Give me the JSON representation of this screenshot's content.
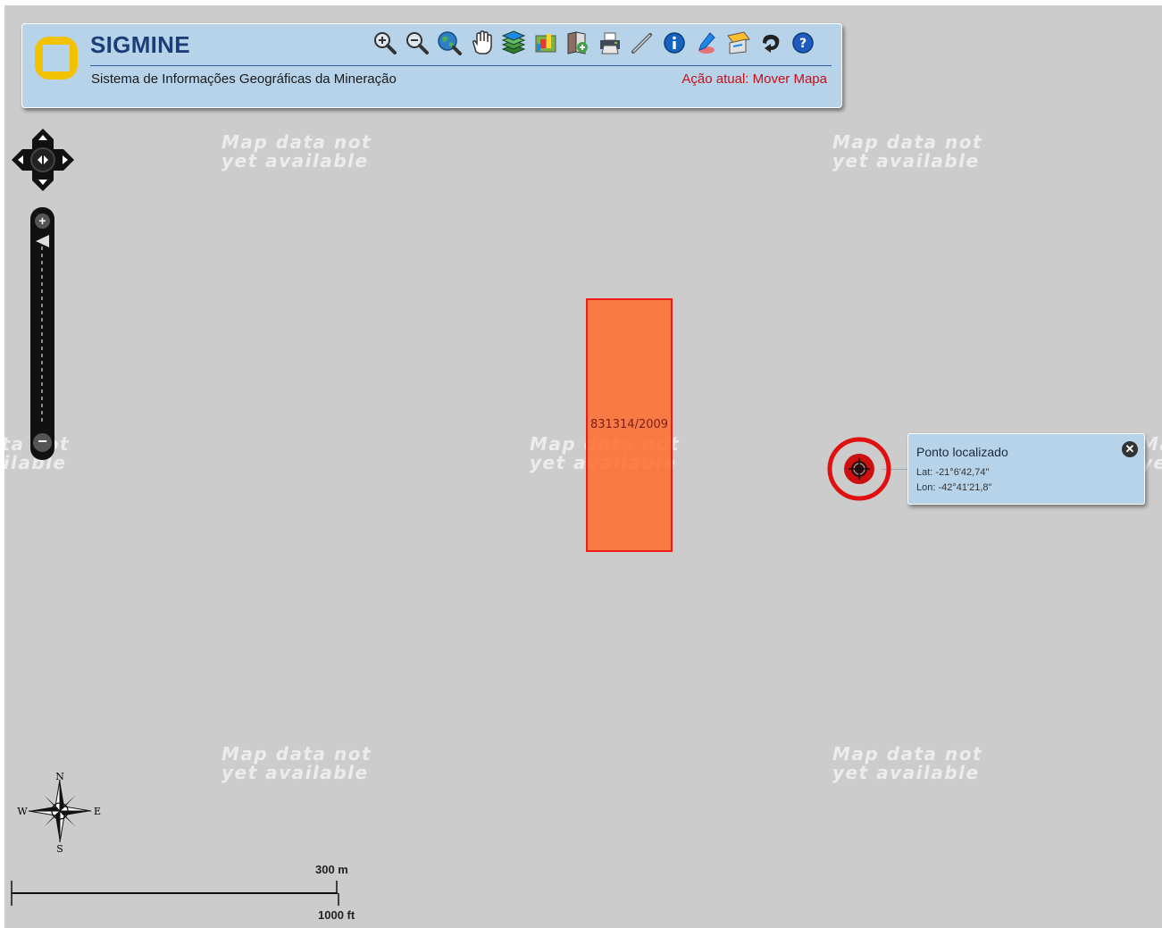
{
  "header": {
    "title": "SIGMINE",
    "subtitle": "Sistema de Informações Geográficas da Mineração",
    "action_label": "Ação atual: Mover Mapa"
  },
  "toolbar": [
    {
      "name": "zoom-in-icon"
    },
    {
      "name": "zoom-out-icon"
    },
    {
      "name": "full-extent-globe-icon"
    },
    {
      "name": "pan-hand-icon"
    },
    {
      "name": "layers-icon"
    },
    {
      "name": "legend-map-icon"
    },
    {
      "name": "add-layer-book-icon"
    },
    {
      "name": "print-icon"
    },
    {
      "name": "measure-pencil-icon"
    },
    {
      "name": "info-icon"
    },
    {
      "name": "locate-point-icon"
    },
    {
      "name": "map-export-icon"
    },
    {
      "name": "previous-view-arrow-icon"
    },
    {
      "name": "help-icon"
    }
  ],
  "map": {
    "no_data_text": "Map data not\nyet available",
    "claim_label": "831314/2009",
    "claim_fill": "#ff6e32",
    "claim_border": "#ee1c1c"
  },
  "popup": {
    "title": "Ponto localizado",
    "lat": "Lat: -21°6'42,74\"",
    "lon": "Lon: -42°41'21,8\""
  },
  "compass": {
    "n": "N",
    "s": "S",
    "e": "E",
    "w": "W"
  },
  "scale": {
    "top": "300 m",
    "bottom": "1000 ft"
  },
  "colors": {
    "panel": "#b7d3ea",
    "title": "#1b3e78",
    "action": "#c4101a",
    "map_bg": "#cccccc"
  }
}
